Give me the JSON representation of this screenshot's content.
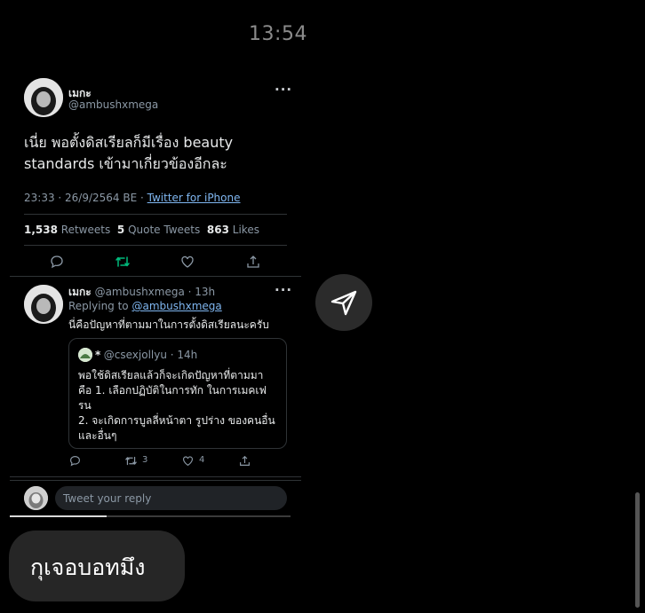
{
  "status_bar": {
    "time": "13:54"
  },
  "main_tweet": {
    "display_name": "เมกะ",
    "handle": "@ambushxmega",
    "text_line1": "เนี่ย พอตั้งดิสเรียลก็มีเรื่อง beauty",
    "text_line2": "standards เข้ามาเกี่ยวข้องอีกละ",
    "timestamp": "23:33 · 26/9/2564 BE · ",
    "source": "Twitter for iPhone",
    "retweets_count": "1,538",
    "retweets_label": "Retweets",
    "quotes_count": "5",
    "quotes_label": "Quote Tweets",
    "likes_count": "863",
    "likes_label": "Likes"
  },
  "reply_tweet": {
    "display_name": "เมกะ",
    "handle_time": "@ambushxmega · 13h",
    "replying_prefix": "Replying to",
    "replying_to": "@ambushxmega",
    "text": "นี่คือปัญหาที่ตามมาในการตั้งดิสเรียลนะครับ",
    "quote": {
      "name": "*",
      "handle_time": "@csexjollyu · 14h",
      "line1": "พอใช้ดิสเรียลแล้วก็จะเกิดปัญหาที่ตามมา",
      "line2": "คือ 1. เลือกปฏิบัติในการทัก ในการเมคเฟ",
      "line3": "รน",
      "line4": "2. จะเกิดการบูลลี่หน้าตา รูปร่าง ของคนอื่น",
      "line5": "และอื่นๆ"
    },
    "retweet_count": "3",
    "like_count": "4"
  },
  "compose": {
    "placeholder": "Tweet your reply"
  },
  "chat_bubble": {
    "text": "กุเจอบอทมึง"
  },
  "colors": {
    "background": "#000000",
    "retweet_green": "#00ba7c",
    "link_blue": "#1d9bf0"
  }
}
